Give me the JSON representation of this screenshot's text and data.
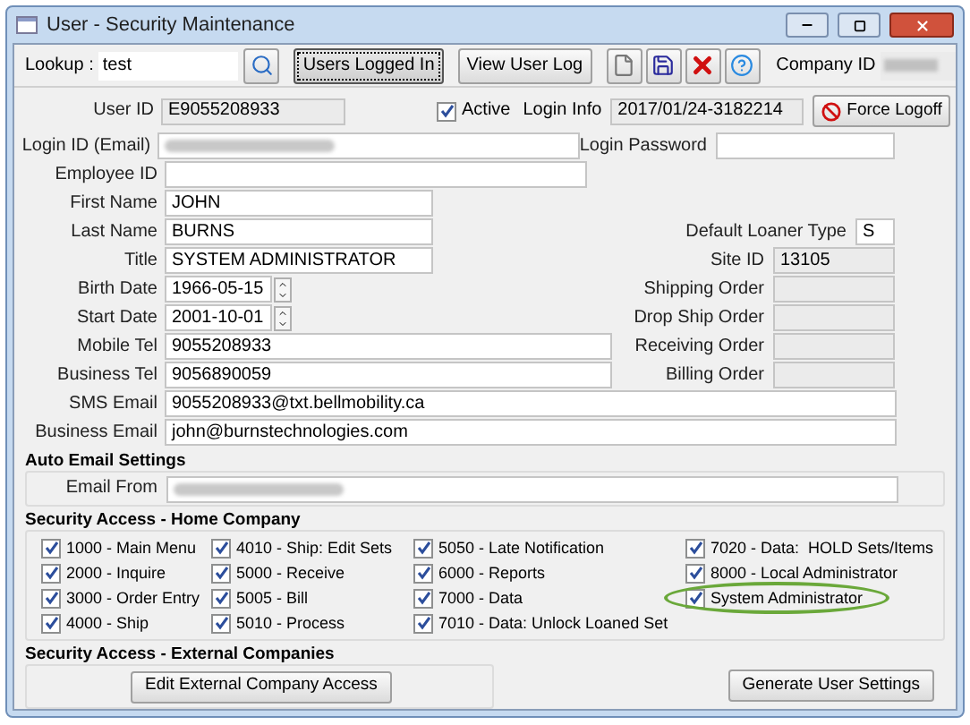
{
  "window": {
    "title": "User - Security Maintenance"
  },
  "toolbar": {
    "lookup_label": "Lookup :",
    "lookup_value": "test",
    "buttons": [
      {
        "label": "Users Logged In",
        "selected": true
      },
      {
        "label": "View User Log",
        "selected": false
      }
    ],
    "company_id_label": "Company ID"
  },
  "user_row": {
    "user_id_label": "User ID",
    "user_id": "E9055208933",
    "active_label": "Active",
    "active_checked": true,
    "login_info_label": "Login Info",
    "login_info": "2017/01/24-3182214",
    "force_logoff": "Force Logoff"
  },
  "fields": [
    {
      "label": "Login ID (Email)",
      "blurred": true,
      "right": {
        "label": "Login Password",
        "readonly": false
      }
    },
    {
      "label": "Employee ID"
    },
    {
      "label": "First Name",
      "value": "JOHN"
    },
    {
      "label": "Last Name",
      "value": "BURNS",
      "right": {
        "label": "Default Loaner Type",
        "value": "S",
        "readonly": false
      }
    },
    {
      "label": "Title",
      "value": "SYSTEM ADMINISTRATOR",
      "right": {
        "label": "Site ID",
        "value": "13105",
        "readonly": true
      }
    },
    {
      "label": "Birth Date",
      "value": "1966-05-15",
      "kind": "spin",
      "right": {
        "label": "Shipping Order",
        "readonly": true
      }
    },
    {
      "label": "Start Date",
      "value": "2001-10-01",
      "kind": "spin",
      "right": {
        "label": "Drop Ship Order",
        "readonly": true
      }
    },
    {
      "label": "Mobile Tel",
      "value": "9055208933",
      "right": {
        "label": "Receiving Order",
        "readonly": true
      }
    },
    {
      "label": "Business Tel",
      "value": "9056890059",
      "right": {
        "label": "Billing Order",
        "readonly": true
      }
    },
    {
      "label": "SMS Email",
      "value": "9055208933@txt.bellmobility.ca"
    },
    {
      "label": "Business Email",
      "value": "john@burnstechnologies.com"
    }
  ],
  "auto_email": {
    "title": "Auto Email Settings",
    "label": "Email From",
    "blurred": true
  },
  "home_company": {
    "title": "Security Access - Home Company",
    "columns": [
      [
        {
          "label": "1000 - Main Menu",
          "checked": true
        },
        {
          "label": "2000 - Inquire",
          "checked": true
        },
        {
          "label": "3000 - Order Entry",
          "checked": true
        },
        {
          "label": "4000 - Ship",
          "checked": true
        }
      ],
      [
        {
          "label": "4010 - Ship: Edit Sets",
          "checked": true
        },
        {
          "label": "5000 - Receive",
          "checked": true
        },
        {
          "label": "5005 - Bill",
          "checked": true
        },
        {
          "label": "5010 - Process",
          "checked": true
        }
      ],
      [
        {
          "label": "5050 - Late Notification",
          "checked": true
        },
        {
          "label": "6000 - Reports",
          "checked": true
        },
        {
          "label": "7000 - Data",
          "checked": true
        },
        {
          "label": "7010 - Data: Unlock Loaned Set",
          "checked": true
        }
      ],
      [
        {
          "label": "7020 - Data:  HOLD Sets/Items",
          "checked": true,
          "highlighted": false
        },
        {
          "label": "8000 - Local Administrator",
          "checked": true,
          "highlighted": false
        },
        {
          "label": "System Administrator",
          "checked": true,
          "highlighted": true
        }
      ]
    ]
  },
  "external": {
    "title": "Security Access - External Companies",
    "button": "Edit External Company Access"
  },
  "generate_button": "Generate User Settings"
}
